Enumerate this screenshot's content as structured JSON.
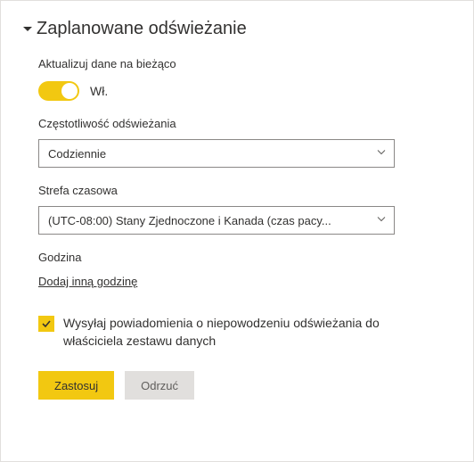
{
  "section": {
    "title": "Zaplanowane odświeżanie"
  },
  "keep_updated": {
    "label": "Aktualizuj dane na bieżąco",
    "state_label": "Wł."
  },
  "frequency": {
    "label": "Częstotliwość odświeżania",
    "value": "Codziennie"
  },
  "timezone": {
    "label": "Strefa czasowa",
    "value": "(UTC-08:00) Stany Zjednoczone i Kanada (czas pacy..."
  },
  "time": {
    "label": "Godzina",
    "add_link": "Dodaj inną godzinę"
  },
  "notify": {
    "label": "Wysyłaj powiadomienia o niepowodzeniu odświeżania do właściciela zestawu danych"
  },
  "buttons": {
    "apply": "Zastosuj",
    "discard": "Odrzuć"
  }
}
